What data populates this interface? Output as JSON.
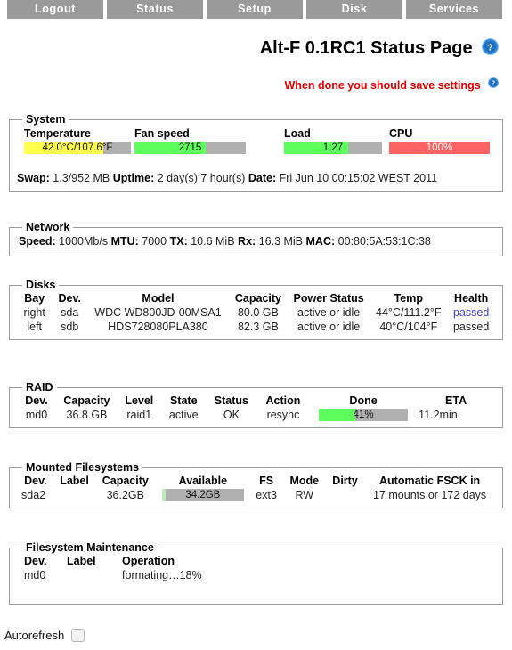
{
  "nav": {
    "tabs": [
      {
        "label": "Logout"
      },
      {
        "label": "Status"
      },
      {
        "label": "Setup"
      },
      {
        "label": "Disk"
      },
      {
        "label": "Services"
      }
    ]
  },
  "header": {
    "title": "Alt-F 0.1RC1 Status Page",
    "help_icon": "help-circle-icon",
    "warning": "When done you should save settings",
    "warning_help_icon": "help-circle-icon",
    "warning_color": "#e00000"
  },
  "system": {
    "legend": "System",
    "metrics": [
      {
        "label": "Temperature",
        "value": "42.0°C/107.6°F",
        "percent": 74,
        "fill_color": "#ffff4d",
        "track_color": "#b0b0b0"
      },
      {
        "label": "Fan speed",
        "value": "2715",
        "percent": 64,
        "fill_color": "#5cff5c",
        "track_color": "#b0b0b0"
      },
      {
        "label": "Load",
        "value": "1.27",
        "percent": 65,
        "fill_color": "#5cff5c",
        "track_color": "#b0b0b0"
      },
      {
        "label": "CPU",
        "value": "100%",
        "percent": 100,
        "fill_color": "#fc6464",
        "track_color": "#b0b0b0"
      }
    ],
    "swap_label": "Swap:",
    "swap_value": "1.3/952 MB",
    "uptime_label": "Uptime:",
    "uptime_value": "2 day(s) 7 hour(s)",
    "date_label": "Date:",
    "date_value": "Fri Jun 10 00:15:02 WEST 2011"
  },
  "network": {
    "legend": "Network",
    "speed_label": "Speed:",
    "speed_value": "1000Mb/s",
    "mtu_label": "MTU:",
    "mtu_value": "7000",
    "tx_label": "TX:",
    "tx_value": "10.6 MiB",
    "rx_label": "Rx:",
    "rx_value": "16.3 MiB",
    "mac_label": "MAC:",
    "mac_value": "00:80:5A:53:1C:38"
  },
  "disks": {
    "legend": "Disks",
    "columns": [
      "Bay",
      "Dev.",
      "Model",
      "Capacity",
      "Power Status",
      "Temp",
      "Health"
    ],
    "rows": [
      {
        "bay": "right",
        "dev": "sda",
        "model": "WDC WD800JD-00MSA1",
        "capacity": "80.0 GB",
        "power_status": "active or idle",
        "temp": "44°C/111.2°F",
        "health": "passed",
        "health_is_link": true
      },
      {
        "bay": "left",
        "dev": "sdb",
        "model": "HDS728080PLA380",
        "capacity": "82.3 GB",
        "power_status": "active or idle",
        "temp": "40°C/104°F",
        "health": "passed",
        "health_is_link": false
      }
    ]
  },
  "raid": {
    "legend": "RAID",
    "columns": [
      "Dev.",
      "Capacity",
      "Level",
      "State",
      "Status",
      "Action",
      "Done",
      "ETA"
    ],
    "rows": [
      {
        "dev": "md0",
        "capacity": "36.8 GB",
        "level": "raid1",
        "state": "active",
        "status": "OK",
        "action": "resync",
        "action_color": "#e02020",
        "done_text": "41%",
        "done_percent": 41,
        "done_fill_color": "#5cff5c",
        "eta": "11.2min"
      }
    ]
  },
  "mounted": {
    "legend": "Mounted Filesystems",
    "columns": [
      "Dev.",
      "Label",
      "Capacity",
      "Available",
      "FS",
      "Mode",
      "Dirty",
      "Automatic FSCK in"
    ],
    "rows": [
      {
        "dev": "sda2",
        "label": "",
        "capacity": "36.2GB",
        "available_text": "34.2GB",
        "available_percent": 5,
        "available_fill_color": "#bfe8bf",
        "fs": "ext3",
        "mode": "RW",
        "dirty": "",
        "fsck": "17 mounts or 172 days"
      }
    ]
  },
  "maintenance": {
    "legend": "Filesystem Maintenance",
    "columns": [
      "Dev.",
      "Label",
      "Operation"
    ],
    "rows": [
      {
        "dev": "md0",
        "label": "",
        "operation": "formating…18%",
        "operation_color": "#e05050"
      }
    ]
  },
  "footer": {
    "autorefresh_label": "Autorefresh",
    "autorefresh_checked": false
  }
}
